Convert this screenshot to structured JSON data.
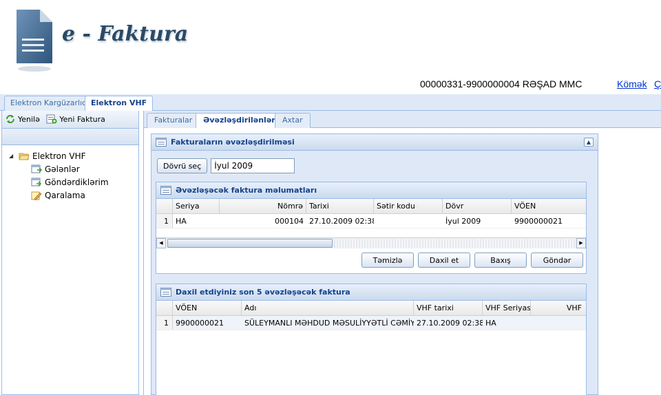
{
  "app": {
    "title": "e - Faktura",
    "user_info": "00000331-9900000004 RƏŞAD MMC",
    "help_link": "Kömək",
    "exit_link": "Ç"
  },
  "main_tabs": [
    {
      "label": "Elektron Kargüzarlıq",
      "active": false
    },
    {
      "label": "Elektron VHF",
      "active": true
    }
  ],
  "left_toolbar": {
    "refresh_label": "Yenilə",
    "new_invoice_label": "Yeni Faktura"
  },
  "tree": {
    "root": "Elektron VHF",
    "children": [
      "Gələnlər",
      "Göndərdiklərim",
      "Qaralama"
    ]
  },
  "sub_tabs": [
    {
      "label": "Fakturalar",
      "active": false
    },
    {
      "label": "Əvəzləşdirilənlər",
      "active": true
    },
    {
      "label": "Axtar",
      "active": false
    }
  ],
  "outer_panel": {
    "title": "Fakturaların əvəzləşdirilməsi",
    "period_button": "Dövrü seç",
    "period_value": "İyul 2009"
  },
  "panel1": {
    "title": "Əvəzləşəcək faktura məlumatları",
    "columns": [
      "Seriya",
      "Nömrə",
      "Tarixi",
      "Sətir kodu",
      "Dövr",
      "VÖEN"
    ],
    "rows": [
      {
        "num": "1",
        "cells": [
          "HA",
          "000104",
          "27.10.2009 02:38...",
          "",
          "İyul 2009",
          "9900000021"
        ]
      }
    ],
    "buttons": {
      "clear": "Təmizlə",
      "enter": "Daxil et",
      "view": "Baxış",
      "send": "Göndər"
    }
  },
  "panel2": {
    "title": "Daxil etdiyiniz son 5 əvəzləşəcək faktura",
    "columns": [
      "VÖEN",
      "Adı",
      "VHF tarixi",
      "VHF Seriyası",
      "VHF"
    ],
    "rows": [
      {
        "num": "1",
        "cells": [
          "9900000021",
          "SÜLEYMANLI MƏHDUD MƏSULİYYƏTLİ CƏMİY...",
          "27.10.2009 02:38...",
          "HA",
          ""
        ]
      }
    ]
  },
  "colors": {
    "brand": "#2a4a66",
    "border": "#99bbe8",
    "header_text": "#15428b",
    "link": "#0033cc"
  }
}
